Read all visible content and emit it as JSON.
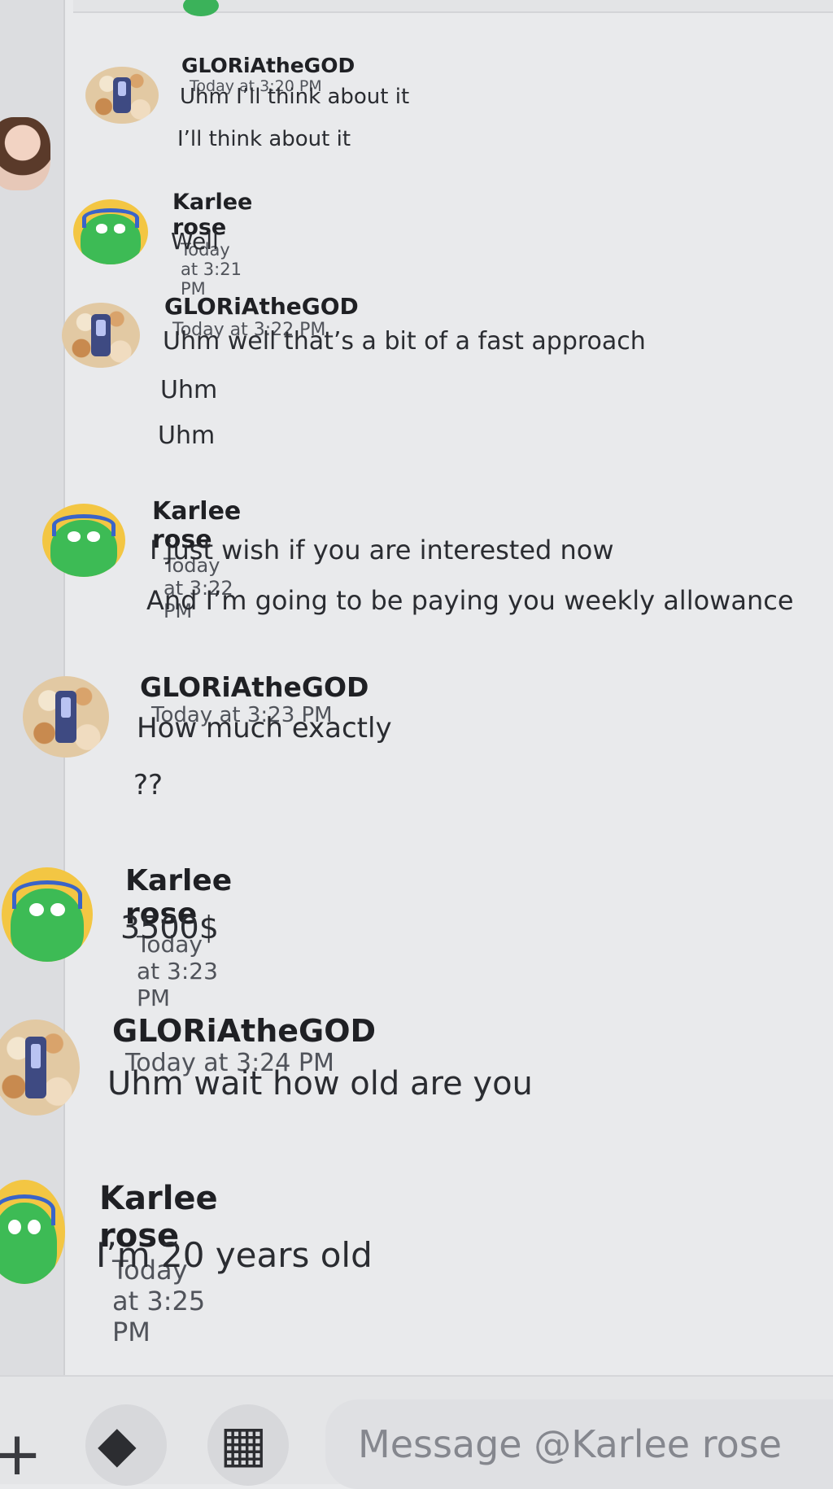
{
  "channel": {
    "recipient": "Karlee rose"
  },
  "messages": [
    {
      "author": "GLORiAtheGOD",
      "timestamp": "Today at 3:20 PM",
      "lines": [
        "Uhm I’ll think about it",
        "I’ll think about it"
      ],
      "avatar": "popcorn-avatar"
    },
    {
      "author": "Karlee rose",
      "timestamp": "Today at 3:21 PM",
      "lines": [
        "Well"
      ],
      "avatar": "frog-avatar"
    },
    {
      "author": "GLORiAtheGOD",
      "timestamp": "Today at 3:22 PM",
      "lines": [
        "Uhm well that’s a bit of a fast approach",
        "Uhm",
        "Uhm"
      ],
      "avatar": "popcorn-avatar"
    },
    {
      "author": "Karlee rose",
      "timestamp": "Today at 3:22 PM",
      "lines": [
        "I just wish if you are interested now",
        "And I’m going to be paying you weekly allowance"
      ],
      "avatar": "frog-avatar"
    },
    {
      "author": "GLORiAtheGOD",
      "timestamp": "Today at 3:23 PM",
      "lines": [
        "How much exactly",
        "??"
      ],
      "avatar": "popcorn-avatar"
    },
    {
      "author": "Karlee rose",
      "timestamp": "Today at 3:23 PM",
      "lines": [
        "3500$"
      ],
      "avatar": "frog-avatar"
    },
    {
      "author": "GLORiAtheGOD",
      "timestamp": "Today at 3:24 PM",
      "lines": [
        "Uhm wait how old are you"
      ],
      "avatar": "popcorn-avatar"
    },
    {
      "author": "Karlee rose",
      "timestamp": "Today at 3:25 PM",
      "lines": [
        "I’m 20 years old"
      ],
      "avatar": "frog-avatar"
    }
  ],
  "composer": {
    "placeholder": "Message @Karlee rose",
    "plus_icon": "plus-icon",
    "apps_icon": "apps-icon",
    "gift_icon": "gift-icon"
  },
  "colors": {
    "background": "#e9eaec",
    "author": "#1f2024",
    "text": "#2a2c31",
    "frog_bg": "#f3c643",
    "frog_green": "#3dbb55"
  }
}
